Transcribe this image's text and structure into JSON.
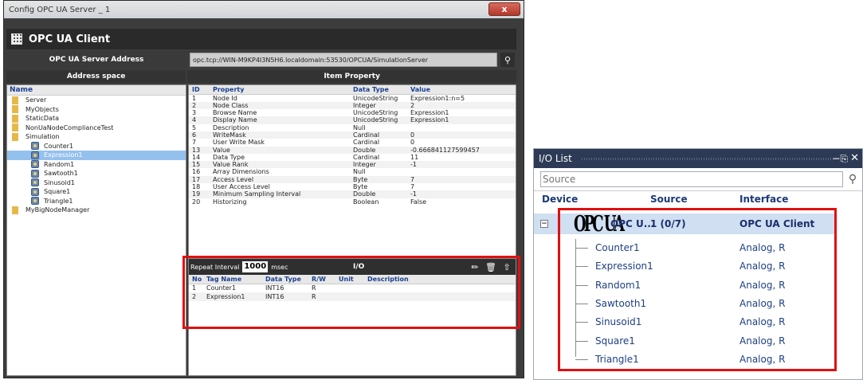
{
  "window": {
    "title": "Config OPC UA Server _ 1",
    "close": "x"
  },
  "client_bar": {
    "title": "OPC UA Client"
  },
  "address": {
    "label": "OPC UA Server Address",
    "value": "opc.tcp://WIN-M9KP4I3N5H6.localdomain:53530/OPCUA/SimulationServer"
  },
  "headers": {
    "address_space": "Address space",
    "item_property": "Item Property"
  },
  "tree": {
    "header": "Name",
    "nodes": [
      {
        "label": "Server",
        "type": "folder"
      },
      {
        "label": "MyObjects",
        "type": "folder"
      },
      {
        "label": "StaticData",
        "type": "folder"
      },
      {
        "label": "NonUaNodeComplianceTest",
        "type": "folder"
      },
      {
        "label": "Simulation",
        "type": "folder"
      },
      {
        "label": "Counter1",
        "type": "variable"
      },
      {
        "label": "Expression1",
        "type": "variable",
        "selected": true
      },
      {
        "label": "Random1",
        "type": "variable"
      },
      {
        "label": "Sawtooth1",
        "type": "variable"
      },
      {
        "label": "Sinusoid1",
        "type": "variable"
      },
      {
        "label": "Square1",
        "type": "variable"
      },
      {
        "label": "Triangle1",
        "type": "variable"
      },
      {
        "label": "MyBigNodeManager",
        "type": "folder"
      }
    ]
  },
  "property_table": {
    "columns": [
      "ID",
      "Property",
      "Data Type",
      "Value"
    ],
    "rows": [
      [
        "1",
        "Node Id",
        "UnicodeString",
        "Expression1:n=5"
      ],
      [
        "2",
        "Node Class",
        "Integer",
        "2"
      ],
      [
        "3",
        "Browse Name",
        "UnicodeString",
        "Expression1"
      ],
      [
        "4",
        "Display Name",
        "UnicodeString",
        "Expression1"
      ],
      [
        "5",
        "Description",
        "Null",
        ""
      ],
      [
        "6",
        "WriteMask",
        "Cardinal",
        "0"
      ],
      [
        "7",
        "User Write Mask",
        "Cardinal",
        "0"
      ],
      [
        "13",
        "Value",
        "Double",
        "-0.666841127599457"
      ],
      [
        "14",
        "Data Type",
        "Cardinal",
        "11"
      ],
      [
        "15",
        "Value Rank",
        "Integer",
        "-1"
      ],
      [
        "16",
        "Array Dimensions",
        "Null",
        ""
      ],
      [
        "17",
        "Access Level",
        "Byte",
        "7"
      ],
      [
        "18",
        "User Access Level",
        "Byte",
        "7"
      ],
      [
        "19",
        "Minimum Sampling Interval",
        "Double",
        "-1"
      ],
      [
        "20",
        "Historizing",
        "Boolean",
        "False"
      ]
    ]
  },
  "io_panel": {
    "repeat_label": "Repeat Interval",
    "repeat_value": "1000",
    "repeat_unit": "msec",
    "title": "I/O",
    "columns": [
      "No",
      "Tag Name",
      "Data Type",
      "R/W",
      "Unit",
      "Description"
    ],
    "rows": [
      [
        "1",
        "Counter1",
        "INT16",
        "R",
        "",
        ""
      ],
      [
        "2",
        "Expression1",
        "INT16",
        "R",
        "",
        ""
      ]
    ]
  },
  "io_list": {
    "title": "I/O List",
    "pin": "-⌂",
    "close": "✕",
    "source_placeholder": "Source",
    "columns": {
      "device": "Device",
      "source": "Source",
      "interface": "Interface"
    },
    "device": {
      "logo": "OPC UA",
      "name": "OPC U...",
      "source": "1 (0/7)",
      "interface": "OPC UA Client"
    },
    "items": [
      {
        "name": "Counter1",
        "interface": "Analog, R"
      },
      {
        "name": "Expression1",
        "interface": "Analog, R"
      },
      {
        "name": "Random1",
        "interface": "Analog, R"
      },
      {
        "name": "Sawtooth1",
        "interface": "Analog, R"
      },
      {
        "name": "Sinusoid1",
        "interface": "Analog, R"
      },
      {
        "name": "Square1",
        "interface": "Analog, R"
      },
      {
        "name": "Triangle1",
        "interface": "Analog, R"
      }
    ]
  },
  "colors": {
    "highlight_red": "#e01010",
    "selection_blue": "#94c0ee",
    "header_blue": "#1a3f8f"
  }
}
